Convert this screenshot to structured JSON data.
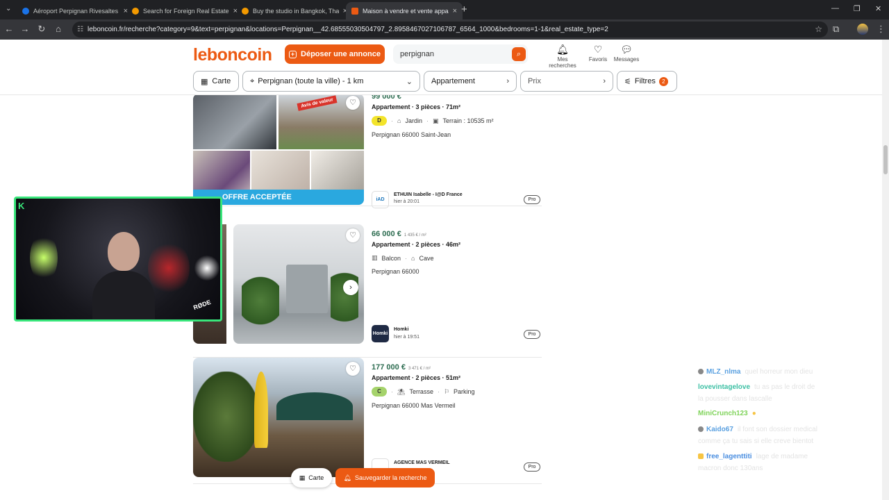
{
  "browser": {
    "tabs": [
      {
        "title": "Aéroport Perpignan Rivesaltes",
        "color": "#1a73e8"
      },
      {
        "title": "Search for Foreign Real Estate",
        "color": "#f29900"
      },
      {
        "title": "Buy the studio in Bangkok, Tha",
        "color": "#f29900"
      },
      {
        "title": "Maison à vendre et vente appa",
        "color": "#ec5a13"
      }
    ],
    "url": "leboncoin.fr/recherche?category=9&text=perpignan&locations=Perpignan__42.68555030504797_2.8958467027106787_6564_1000&bedrooms=1-1&real_estate_type=2"
  },
  "header": {
    "logo": "leboncoin",
    "post_label": "Déposer une annonce",
    "search_value": "perpignan",
    "icons": [
      {
        "label": "Mes recherches",
        "icon": "bell-icon"
      },
      {
        "label": "Favoris",
        "icon": "heart-icon"
      },
      {
        "label": "Messages",
        "icon": "chat-icon"
      }
    ]
  },
  "filters": {
    "map": "Carte",
    "location": "Perpignan (toute la ville) - 1 km",
    "type": "Appartement",
    "price": "Prix",
    "filters": "Filtres",
    "filters_count": "2"
  },
  "listings": [
    {
      "price": "99 000 €",
      "title": "Appartement · 3 pièces · 71m²",
      "dpe": "D",
      "dpe_color": "#f3e42a",
      "features": [
        "Jardin",
        "Terrain : 10535 m²"
      ],
      "location": "Perpignan 66000 Saint-Jean",
      "seller": "ETHUIN Isabelle - I@D France",
      "seller_logo": "iAD",
      "time": "hier à 20:01",
      "pro": "Pro",
      "photo_banner": "OFFRE ACCEPTÉE",
      "photo_tag": "Avis de valeur"
    },
    {
      "price": "66 000 €",
      "ppm": "1 435 € / m²",
      "title": "Appartement · 2 pièces · 46m²",
      "features": [
        "Balcon",
        "Cave"
      ],
      "location": "Perpignan 66000",
      "seller": "Homki",
      "seller_logo": "Homki",
      "time": "hier à 19:51",
      "pro": "Pro"
    },
    {
      "price": "177 000 €",
      "ppm": "3 471 € / m²",
      "title": "Appartement · 2 pièces · 51m²",
      "dpe": "C",
      "dpe_color": "#a5d36b",
      "features": [
        "Terrasse",
        "Parking"
      ],
      "location": "Perpignan 66000 Mas Vermeil",
      "seller": "AGENCE MAS VERMEIL",
      "pro": "Pro"
    }
  ],
  "bottom": {
    "map": "Carte",
    "save": "Sauvegarder la recherche"
  },
  "stream": {
    "rode": "RØDE",
    "chat": [
      {
        "user": "MLZ_nlma",
        "color": "#5aa0e0",
        "text": "quel horreur mon dieu"
      },
      {
        "user": "lovevintagelove",
        "color": "#3bbfa3",
        "text": "tu as pas le droit de",
        "text2": "la pousser dans lascalle"
      },
      {
        "user": "MiniCrunch123",
        "color": "#7fd35a",
        "text": ""
      },
      {
        "user": "Kaido67",
        "color": "#5aa0e0",
        "text": "il font son dossier medical",
        "text2": "comme ça tu sais si elle creve bientot"
      },
      {
        "user": "free_lagenttiti",
        "color": "#4a8ee0",
        "text": "lage de madame",
        "text2": "macron donc 130ans"
      }
    ]
  }
}
